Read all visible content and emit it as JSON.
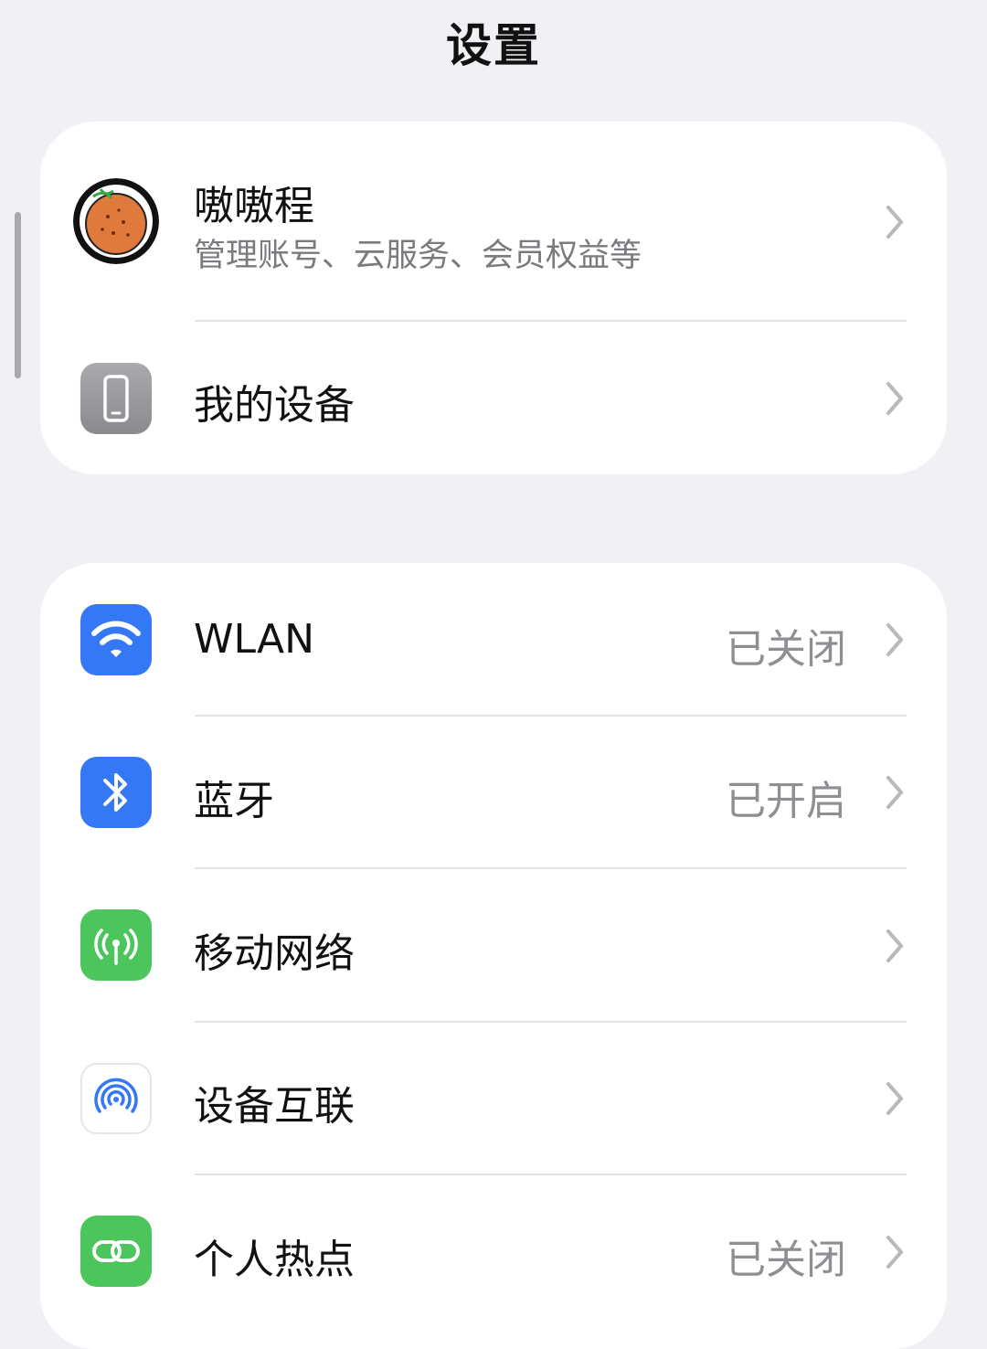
{
  "header": {
    "title": "设置"
  },
  "account": {
    "name": "嗷嗷程",
    "subtitle": "管理账号、云服务、会员权益等"
  },
  "my_device": {
    "label": "我的设备"
  },
  "connectivity": [
    {
      "label": "WLAN",
      "value": "已关闭",
      "icon": "wifi-icon",
      "color": "#3478f6"
    },
    {
      "label": "蓝牙",
      "value": "已开启",
      "icon": "bluetooth-icon",
      "color": "#3478f6"
    },
    {
      "label": "移动网络",
      "value": "",
      "icon": "cellular-icon",
      "color": "#4cc55d"
    },
    {
      "label": "设备互联",
      "value": "",
      "icon": "device-connect-icon",
      "color": "#3478f6"
    },
    {
      "label": "个人热点",
      "value": "已关闭",
      "icon": "hotspot-icon",
      "color": "#4cc55d"
    }
  ]
}
